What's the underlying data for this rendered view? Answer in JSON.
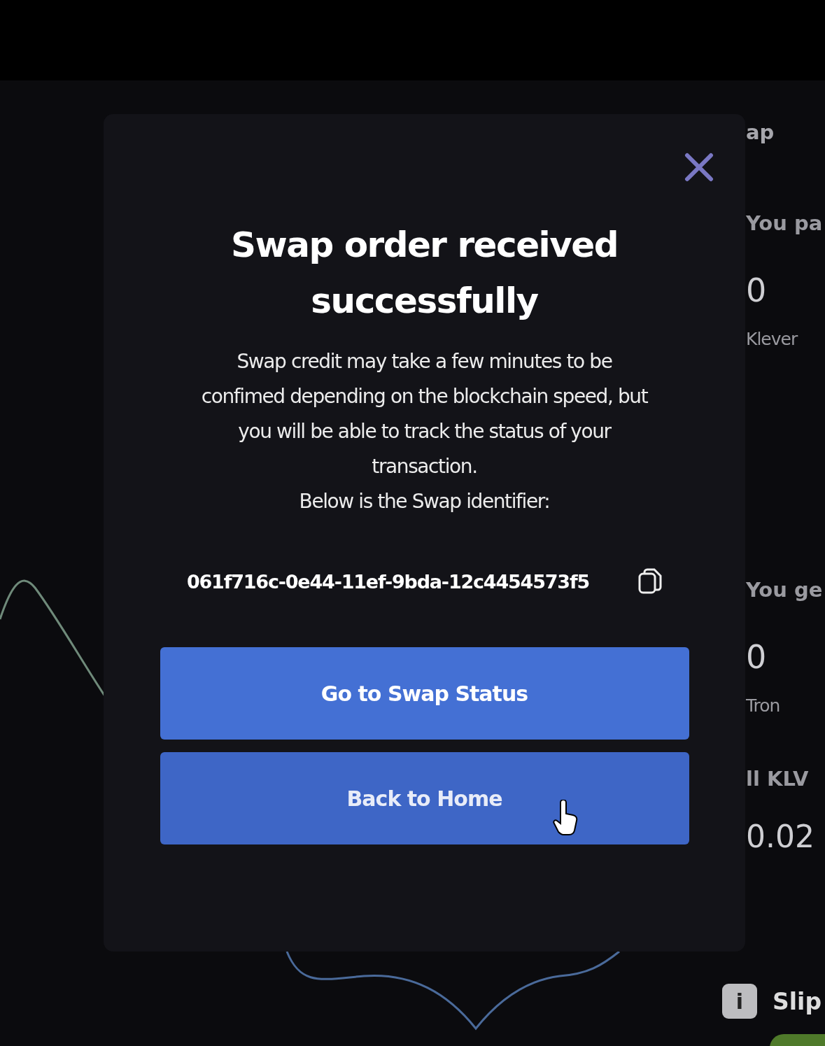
{
  "swap_panel": {
    "heading": "ap",
    "pay_label": "You pa",
    "pay_amount": "0",
    "pay_asset": "Klever",
    "get_label": "You ge",
    "get_amount": "0",
    "get_asset": "Tron",
    "rate_label": "ll KLV",
    "rate_value": "0.02",
    "info_icon": "i",
    "slippage_label": "Slip"
  },
  "modal": {
    "title": "Swap order received successfully",
    "message": "Swap credit may take a few minutes to be confimed depending on the blockchain speed, but you will be able to track the status of your transaction.",
    "identifier_label": "Below is the Swap identifier:",
    "identifier": "061f716c-0e44-11ef-9bda-12c4454573f5",
    "buttons": [
      {
        "label": "Go to Swap Status",
        "hovered": false
      },
      {
        "label": "Back to Home",
        "hovered": true
      }
    ]
  }
}
